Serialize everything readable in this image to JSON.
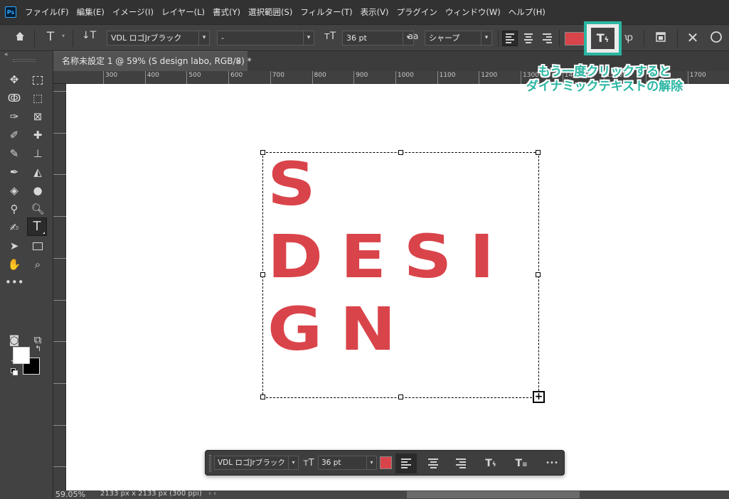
{
  "menubar": {
    "logo": "Ps",
    "items": [
      "ファイル(F)",
      "編集(E)",
      "イメージ(I)",
      "レイヤー(L)",
      "書式(Y)",
      "選択範囲(S)",
      "フィルター(T)",
      "表示(V)",
      "プラグイン",
      "ウィンドウ(W)",
      "ヘルプ(H)"
    ]
  },
  "options_bar": {
    "font_family": "VDL ロゴJrブラック",
    "font_style": "-",
    "font_size": "36 pt",
    "antialias_icon_text": "aa",
    "antialias": "シャープ",
    "text_color": "#d9444a",
    "icons": [
      "home-icon",
      "type-tool-icon",
      "text-orientation-icon",
      "font-size-icon",
      "antialias-icon",
      "align-left-icon",
      "align-center-icon",
      "align-right-icon",
      "dynamic-text-icon",
      "warp-text-icon",
      "panels-icon",
      "cancel-icon",
      "commit-icon"
    ]
  },
  "document": {
    "tab_title": "名称未設定 1 @ 59% (S  design labo, RGB/8) *",
    "close_glyph": "×"
  },
  "ruler": {
    "top_labels": [
      "300",
      "400",
      "500",
      "600",
      "700",
      "800",
      "900",
      "1000",
      "1100",
      "1200",
      "1300",
      "1400",
      "1500",
      "1600",
      "1700"
    ]
  },
  "canvas": {
    "text_lines": [
      "S",
      "DESI",
      "GN"
    ],
    "text_color": "#d9444a",
    "background": "#ffffff"
  },
  "task_bar": {
    "font_family": "VDL ロゴJrブラック",
    "font_size": "36 pt",
    "color": "#d9444a",
    "more": "•••"
  },
  "status": {
    "zoom": "59.05%",
    "doc_size": "2133 px x 2133 px (300 ppi)",
    "arrows": "›  ‹"
  },
  "annotation": {
    "line1": "もう一度クリックすると",
    "line2": "ダイナミックテキストの解除",
    "accent": "#2bb6a3"
  },
  "colors": {
    "foreground": "#ffffff",
    "background": "#000000",
    "ui_dark": "#323232",
    "ui_panel": "#424242"
  }
}
